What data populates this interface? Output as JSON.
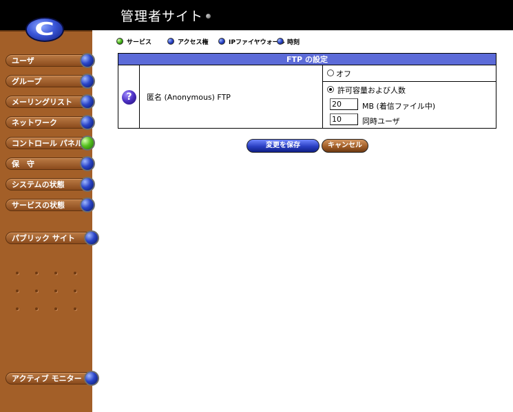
{
  "header": {
    "title": "管理者サイト"
  },
  "logo": {
    "letter": "C"
  },
  "sidebar": {
    "items": [
      {
        "label": "ユーザ",
        "led": "blue"
      },
      {
        "label": "グループ",
        "led": "blue"
      },
      {
        "label": "メーリングリスト",
        "led": "blue"
      },
      {
        "label": "ネットワーク",
        "led": "blue"
      },
      {
        "label": "コントロール パネル",
        "led": "green"
      },
      {
        "label": "保　守",
        "led": "blue"
      },
      {
        "label": "システムの状態",
        "led": "blue"
      },
      {
        "label": "サービスの状態",
        "led": "blue"
      }
    ],
    "public_site": "パブリック サイト",
    "active_monitor": "アクティブ モニター"
  },
  "tabs": [
    {
      "label": "サービス",
      "led": "green"
    },
    {
      "label": "アクセス権",
      "led": "blue"
    },
    {
      "label": "IPファイヤウォール",
      "led": "blue"
    },
    {
      "label": "時刻",
      "led": "blue"
    }
  ],
  "ftp": {
    "title": "FTP の設定",
    "help_symbol": "?",
    "label": "匿名 (Anonymous) FTP",
    "off_label": "オフ",
    "on_label": "許可容量および人数",
    "selected": "on",
    "capacity_value": "20",
    "capacity_unit": "MB (着信ファイル中)",
    "users_value": "10",
    "users_unit": "同時ユーザ"
  },
  "buttons": {
    "save": "変更を保存",
    "cancel": "キャンセル"
  },
  "colors": {
    "header_bg": "#000000",
    "sidebar_bg": "#a35f28",
    "table_header_bg": "#5c6bd8",
    "save_button": "#2a3fc2",
    "cancel_button": "#a35f28"
  }
}
